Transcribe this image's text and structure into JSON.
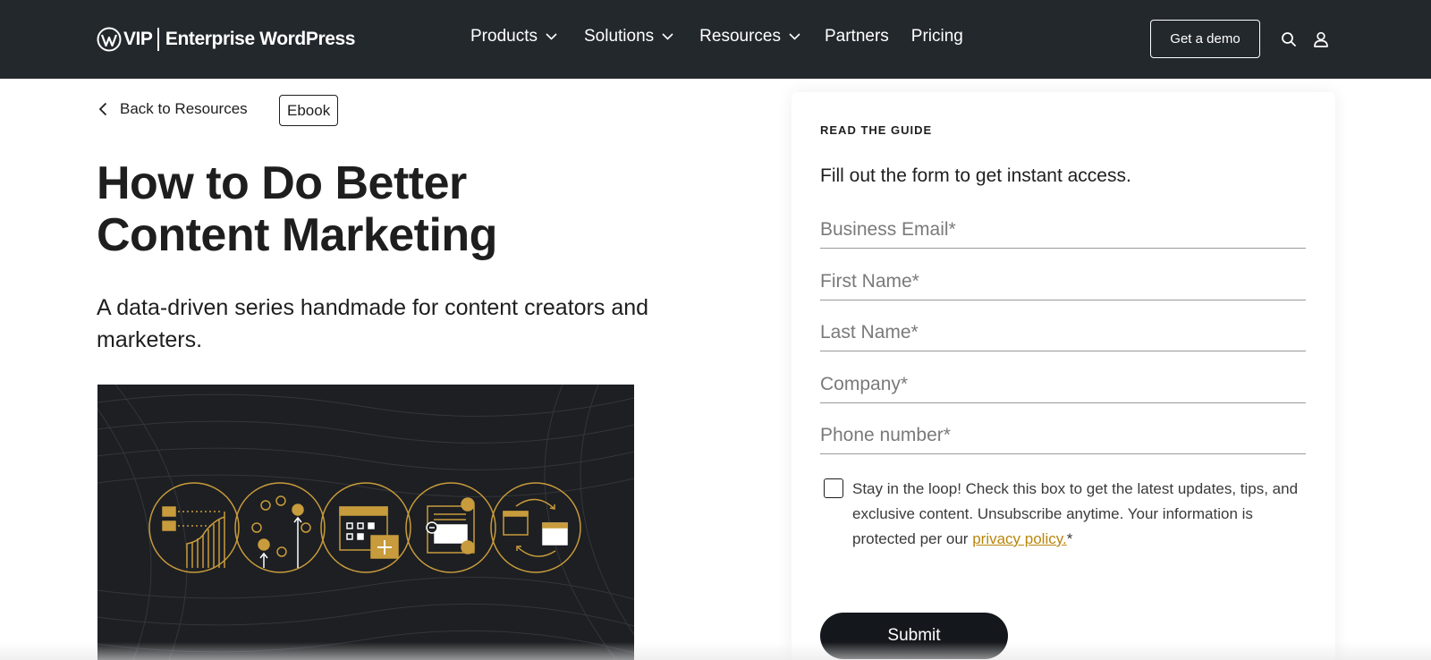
{
  "header": {
    "brand_vip": "VIP",
    "brand_name": "Enterprise WordPress",
    "nav": [
      {
        "label": "Products",
        "has_dropdown": true
      },
      {
        "label": "Solutions",
        "has_dropdown": true
      },
      {
        "label": "Resources",
        "has_dropdown": true
      },
      {
        "label": "Partners",
        "has_dropdown": false
      },
      {
        "label": "Pricing",
        "has_dropdown": false
      }
    ],
    "demo_label": "Get a demo",
    "icons": [
      "search-icon",
      "user-icon"
    ]
  },
  "content": {
    "back_label": "Back to Resources",
    "tag": "Ebook",
    "title_line1": "How to Do Better",
    "title_line2": "Content Marketing",
    "subtitle": "A data-driven series handmade for content creators and marketers."
  },
  "form": {
    "eyebrow": "READ THE GUIDE",
    "lead": "Fill out the form to get instant access.",
    "fields": [
      {
        "placeholder": "Business Email*",
        "value": ""
      },
      {
        "placeholder": "First Name*",
        "value": ""
      },
      {
        "placeholder": "Last Name*",
        "value": ""
      },
      {
        "placeholder": "Company*",
        "value": ""
      },
      {
        "placeholder": "Phone number*",
        "value": ""
      }
    ],
    "consent_text": "Stay in the loop! Check this box to get the latest updates, tips, and exclusive content. Unsubscribe anytime. Your information is protected per our ",
    "privacy_link": "privacy policy.",
    "consent_required": "*",
    "checkbox_checked": false,
    "submit_label": "Submit"
  },
  "colors": {
    "header_bg": "#23282d",
    "accent_gold": "#c89b3c",
    "link_gold": "#b8860b",
    "submit_bg": "#14171b"
  }
}
